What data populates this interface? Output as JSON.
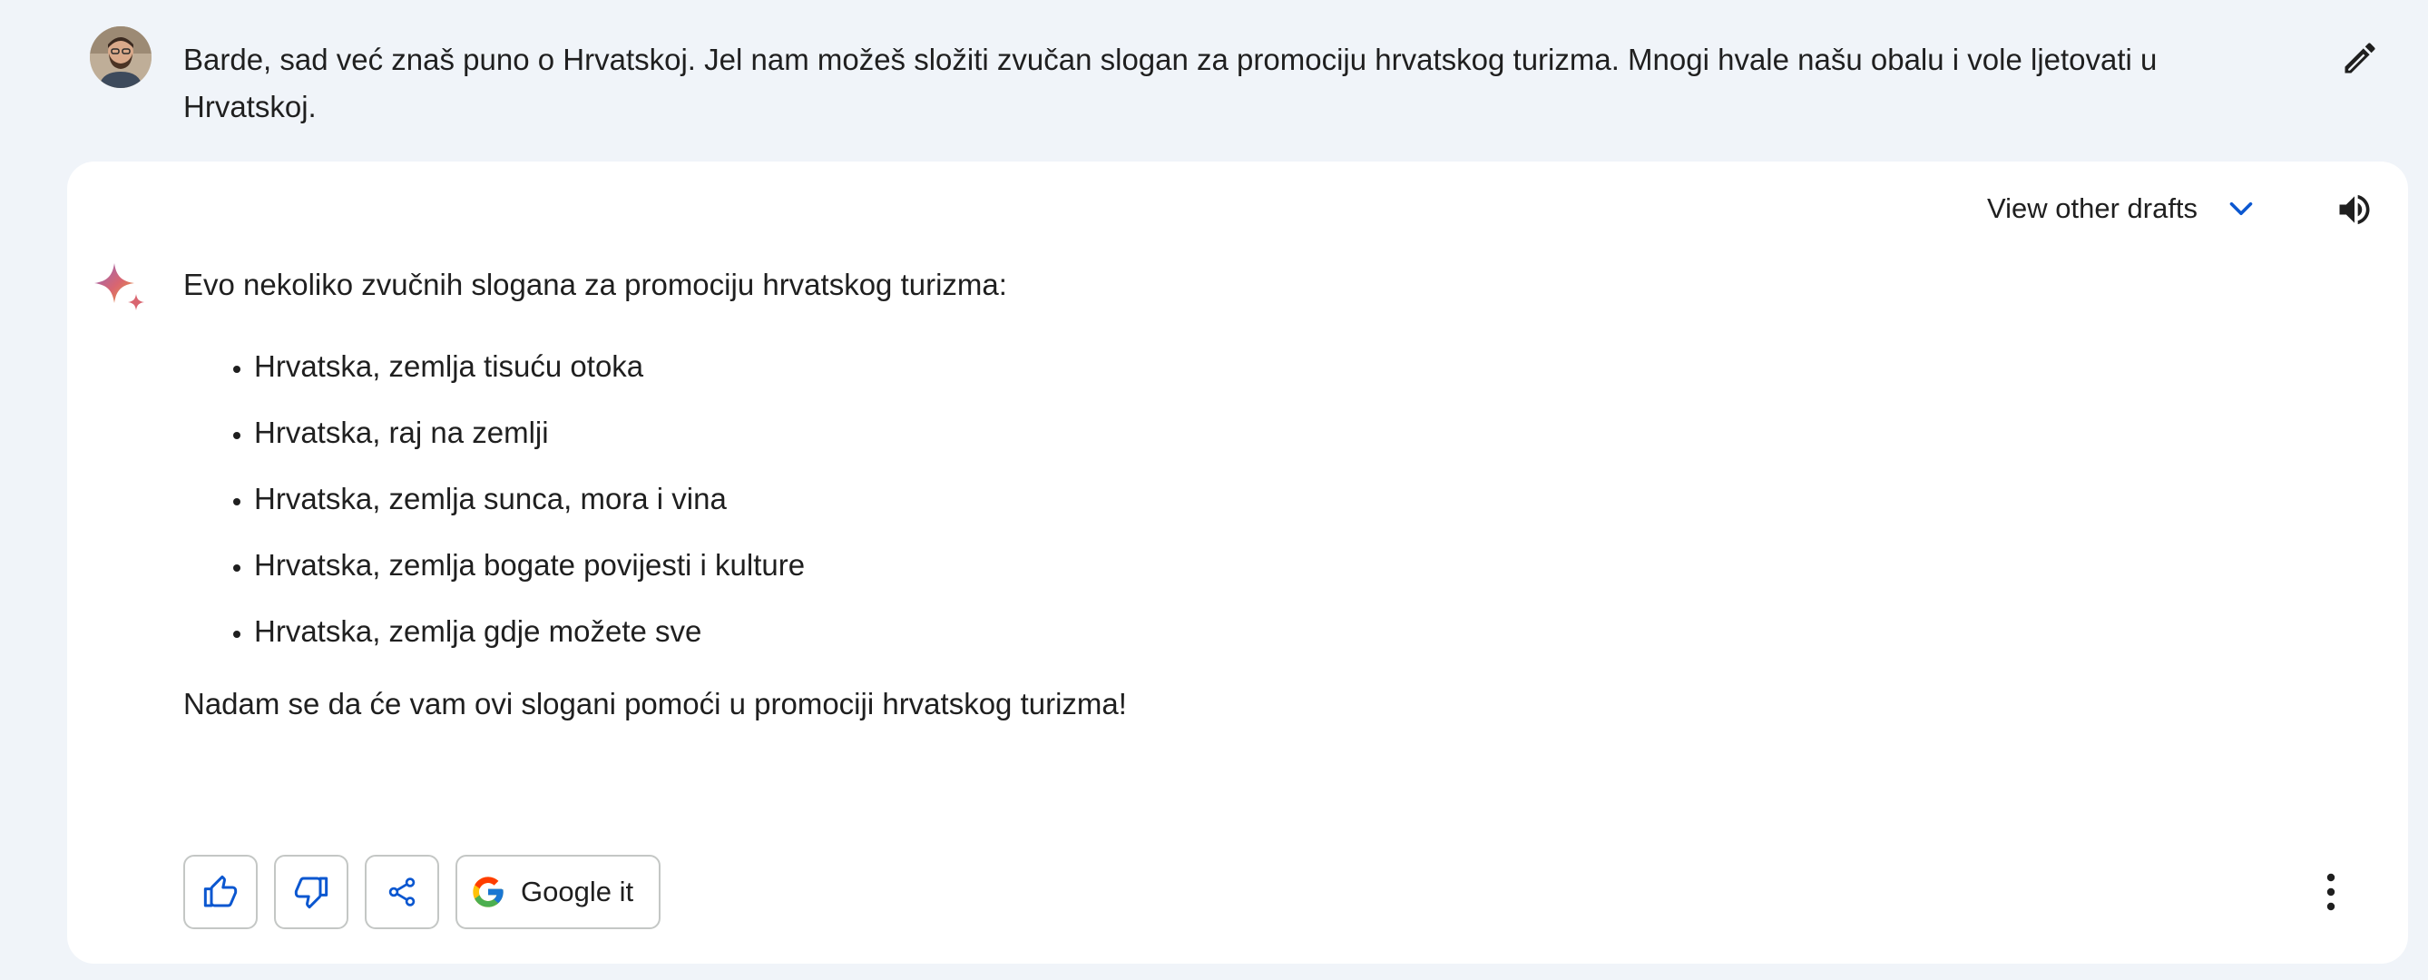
{
  "prompt": {
    "text": "Barde, sad već znaš puno o Hrvatskoj. Jel nam možeš složiti zvučan slogan za promociju hrvatskog turizma. Mnogi hvale našu obalu i vole ljetovati u Hrvatskoj.",
    "avatar_icon": "user-avatar",
    "edit_icon": "pencil-icon"
  },
  "response": {
    "drafts_label": "View other drafts",
    "drafts_icon": "chevron-down-icon",
    "speaker_icon": "speaker-icon",
    "sparkle_icon": "bard-sparkle-icon",
    "intro": "Evo nekoliko zvučnih slogana za promociju hrvatskog turizma:",
    "slogans": [
      "Hrvatska, zemlja tisuću otoka",
      "Hrvatska, raj na zemlji",
      "Hrvatska, zemlja sunca, mora i vina",
      "Hrvatska, zemlja bogate povijesti i kulture",
      "Hrvatska, zemlja gdje možete sve"
    ],
    "outro": "Nadam se da će vam ovi slogani pomoći u promociji hrvatskog turizma!"
  },
  "actions": {
    "thumbs_up_icon": "thumbs-up-icon",
    "thumbs_down_icon": "thumbs-down-icon",
    "share_icon": "share-icon",
    "google_icon": "google-g-icon",
    "google_label": "Google it",
    "more_icon": "more-vert-icon"
  },
  "colors": {
    "page_background": "#f0f4f9",
    "card_background": "#ffffff",
    "text": "#1f1f1f",
    "accent_blue": "#0b57d0",
    "button_border": "#c4c7c5"
  }
}
